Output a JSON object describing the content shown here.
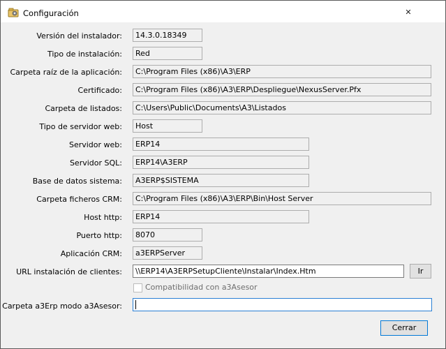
{
  "window": {
    "title": "Configuración",
    "icon": "app-config-icon",
    "close_glyph": "✕"
  },
  "rows": [
    {
      "label": "Versión del instalador:",
      "value": "14.3.0.18349"
    },
    {
      "label": "Tipo de instalación:",
      "value": "Red"
    },
    {
      "label": "Carpeta raíz de la aplicación:",
      "value": "C:\\Program Files (x86)\\A3\\ERP"
    },
    {
      "label": "Certificado:",
      "value": "C:\\Program Files (x86)\\A3\\ERP\\Despliegue\\NexusServer.Pfx"
    },
    {
      "label": "Carpeta de listados:",
      "value": "C:\\Users\\Public\\Documents\\A3\\Listados"
    },
    {
      "label": "Tipo de servidor web:",
      "value": "Host"
    },
    {
      "label": "Servidor web:",
      "value": "ERP14"
    },
    {
      "label": "Servidor SQL:",
      "value": "ERP14\\A3ERP"
    },
    {
      "label": "Base de datos sistema:",
      "value": "A3ERP$SISTEMA"
    },
    {
      "label": "Carpeta ficheros CRM:",
      "value": "C:\\Program Files (x86)\\A3\\ERP\\Bin\\Host Server"
    },
    {
      "label": "Host http:",
      "value": "ERP14"
    },
    {
      "label": "Puerto http:",
      "value": "8070"
    },
    {
      "label": "Aplicación CRM:",
      "value": "a3ERPServer"
    }
  ],
  "url_row": {
    "label": "URL instalación de clientes:",
    "value": "\\\\ERP14\\A3ERPSetupCliente\\Instalar\\Index.Htm",
    "button_label": "Ir"
  },
  "checkbox": {
    "label": "Compatibilidad con a3Asesor",
    "checked": false
  },
  "a3asesor_row": {
    "label": "Carpeta a3Erp modo a3Asesor:",
    "value": ""
  },
  "buttons": {
    "close_label": "Cerrar"
  },
  "colors": {
    "focus_border": "#2a7fd4",
    "default_button_border": "#0078d7",
    "window_background": "#f0f0f0"
  }
}
